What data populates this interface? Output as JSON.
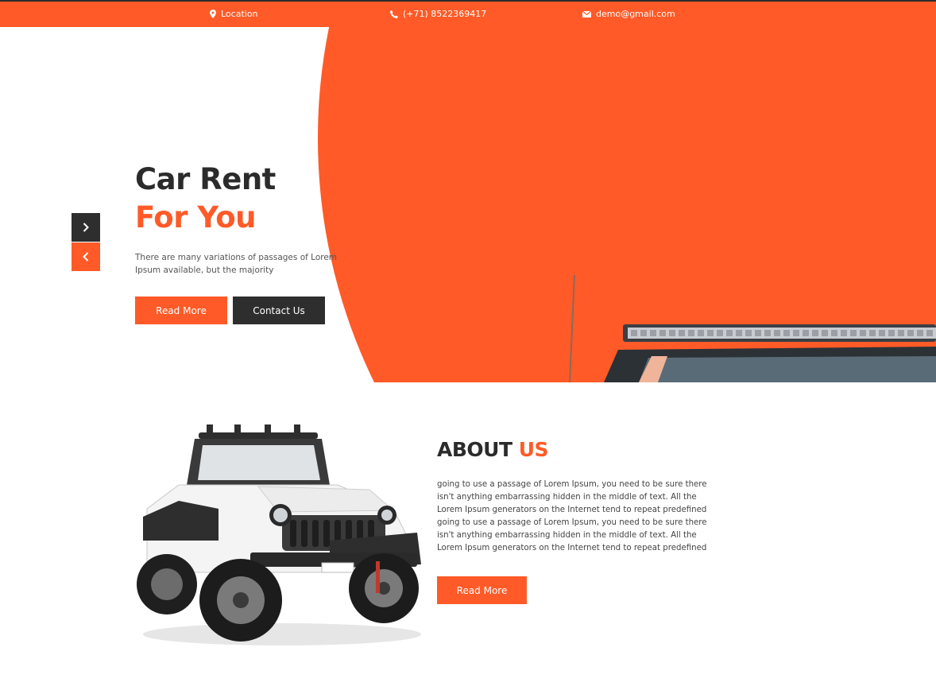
{
  "topbar": {
    "location": "Location",
    "phone": "(+71) 8522369417",
    "email": "demo@gmail.com",
    "icons": [
      "map-pin-icon",
      "phone-icon",
      "envelope-icon"
    ]
  },
  "hero": {
    "title_line1": "Car Rent",
    "title_line2": "For You",
    "text": "There are many variations of passages of Lorem Ipsum available, but the majority",
    "read_more": "Read More",
    "contact_us": "Contact Us"
  },
  "about": {
    "title_part1": "ABOUT",
    "title_part2": "US",
    "text": "going to use a passage of Lorem Ipsum, you need to be sure there isn't anything embarrassing hidden in the middle of text. All the Lorem Ipsum generators on the Internet tend to repeat predefined going to use a passage of Lorem Ipsum, you need to be sure there isn't anything embarrassing hidden in the middle of text. All the Lorem Ipsum generators on the Internet tend to repeat predefined",
    "read_more": "Read More"
  },
  "colors": {
    "accent": "#ff5a27",
    "dark": "#2e2e2e"
  }
}
